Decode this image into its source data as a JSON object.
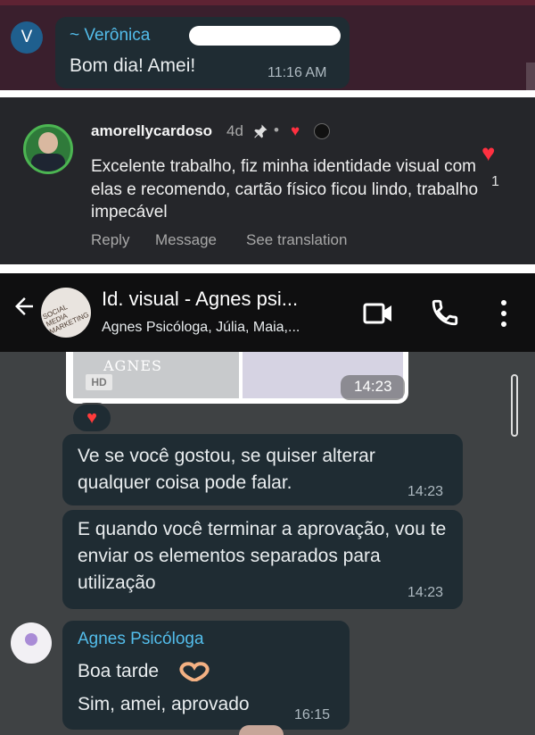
{
  "panel1": {
    "avatar_letter": "V",
    "sender": "~ Verônica",
    "message": "Bom dia! Amei!",
    "time": "11:16 AM"
  },
  "panel2": {
    "username": "amorellycardoso",
    "age": "4d",
    "pin_icon": "pin-icon",
    "separator": "•",
    "comment": "Excelente trabalho, fiz minha identidade visual com elas e recomendo, cartão físico ficou lindo, trabalho impecável",
    "actions": {
      "reply": "Reply",
      "message": "Message",
      "translate": "See translation"
    },
    "like_count": "1",
    "colors": {
      "heart": "#ff3040",
      "background": "#25262a"
    }
  },
  "panel3": {
    "header": {
      "title": "Id. visual - Agnes psi...",
      "subtitle": "Agnes Psicóloga, Júlia, Maia,...",
      "group_avatar_text": "SOCIAL MEDIA MARKETING"
    },
    "image_message": {
      "brand": "AGNES",
      "hd_badge": "HD",
      "time": "14:23"
    },
    "messages": [
      {
        "text": "Ve se você gostou, se quiser alterar qualquer coisa pode falar.",
        "time": "14:23"
      },
      {
        "text": "E quando você terminar a aprovação, vou te enviar os elementos separados para utilização",
        "time": "14:23"
      }
    ],
    "agnes": {
      "sender": "Agnes Psicóloga",
      "line1": "Boa tarde",
      "line2": "Sim, amei, aprovado",
      "time": "16:15"
    },
    "colors": {
      "bubble": "#1f2c33",
      "sender_name": "#53bdeb",
      "background": "#3f4244"
    }
  }
}
